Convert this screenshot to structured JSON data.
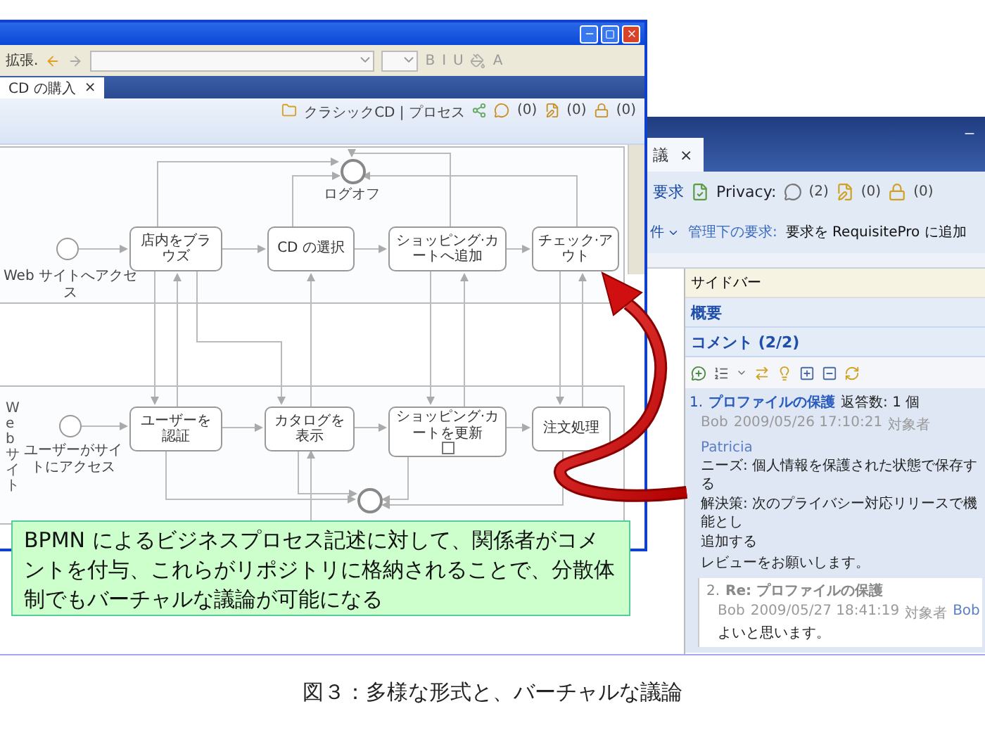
{
  "left_window": {
    "toolbar": {
      "label": "拡張.",
      "format_buttons": [
        "B",
        "I",
        "U"
      ],
      "font_color_button": "A"
    },
    "tabs": [
      {
        "label": "CD の購入",
        "close": "×"
      }
    ],
    "process_bar": {
      "label": "クラシックCD | プロセス",
      "counts": [
        "(0)",
        "(0)",
        "(0)"
      ]
    },
    "diagram": {
      "top_pool": {
        "start_label": "Web サイトへアクセス",
        "end_label": "ログオフ",
        "tasks": [
          {
            "label": "店内をブラウズ",
            "kind": "task"
          },
          {
            "label": "CD の選択",
            "kind": "task"
          },
          {
            "label": "ショッピング·カートへ追加",
            "kind": "task"
          },
          {
            "label": "チェック·アウト",
            "kind": "task"
          }
        ]
      },
      "bottom_pool": {
        "lane_label": "Web サイト",
        "start_label": "ユーザーがサイトにアクセス",
        "tasks": [
          {
            "label": "ユーザーを認証",
            "kind": "task"
          },
          {
            "label": "カタログを表示",
            "kind": "task"
          },
          {
            "label": "ショッピング·カートを更新",
            "kind": "subprocess"
          },
          {
            "label": "注文処理",
            "kind": "task"
          }
        ]
      }
    }
  },
  "caption_box": "BPMN によるビジネスプロセス記述に対して、関係者がコメントを付与、これらがリポジトリに格納されることで、分散体制でもバーチャルな議論が可能になる",
  "right_window": {
    "tab": {
      "label": "議",
      "close": "×"
    },
    "toolbar": {
      "label": "要求",
      "privacy": "Privacy:",
      "counts": [
        "(2)",
        "(0)",
        "(0)"
      ]
    },
    "requirements_row": {
      "menu": "件",
      "managed_label": "管理下の要求:",
      "action": "要求を RequisitePro に追加"
    },
    "sidebar": {
      "title": "サイドバー",
      "sections": [
        "概要",
        "コメント (2/2)"
      ]
    },
    "comments": [
      {
        "number": "1.",
        "title": "プロファイルの保護",
        "replies": "返答数: 1 個",
        "author": "Bob",
        "date": "2009/05/26  17:10:21",
        "target_label": "対象者",
        "target": "Patricia",
        "selected": true,
        "body": [
          "ニーズ: 個人情報を保護された状態で保存する",
          "解決策: 次のプライバシー対応リリースで機能とし",
          "追加する",
          "レビューをお願いします。"
        ],
        "children": [
          {
            "number": "2.",
            "title": "Re: プロファイルの保護",
            "author": "Bob",
            "date": "2009/05/27  18:41:19",
            "target_label": "対象者",
            "target": "Bob",
            "selected": false,
            "body": [
              "よいと思います。"
            ]
          }
        ]
      }
    ]
  },
  "figure_caption": "図３：多様な形式と、バーチャルな議論"
}
